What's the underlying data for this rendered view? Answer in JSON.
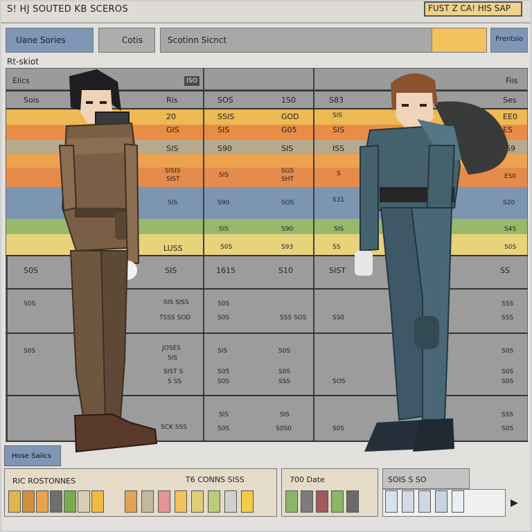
{
  "app": {
    "title": "S! HJ SOUTED KB SCEROS",
    "top_right": "FUST Z CA! HIS SAP"
  },
  "nav": {
    "tab1": "Uane Sories",
    "tab2": "Cotis",
    "search": "Scotinn Sicnct",
    "btn": "Prentsio"
  },
  "subheader": "Rt-skiot",
  "table": {
    "header_left": "Eiics",
    "header_badge": "ISO",
    "header_right": "Fiis",
    "rows": [
      {
        "c1": "Sois",
        "c2": "Ris",
        "c3": "SOS",
        "c4": "1S0",
        "c5": "S83",
        "c6": "Ses"
      },
      {
        "c2": "20",
        "c3": "SSIS",
        "c4": "GOD",
        "c5": "SIS",
        "c6": "EE0"
      },
      {
        "c2": "GIS",
        "c3": "SIS",
        "c4": "G05",
        "c5": "SIS",
        "c6": "ES"
      },
      {
        "c2": "SIS",
        "c3": "S90",
        "c4": "SIS",
        "c5": "ISS",
        "c6": "S9"
      },
      {
        "c2a": "SISIS",
        "c2": "SIST",
        "c3": "SIS",
        "c4": "SGS",
        "c4b": "SHT",
        "c5": "S",
        "c6": "ES0"
      },
      {
        "c2": "SIS",
        "c3": "S90",
        "c4": "SOS",
        "c5": "S31",
        "c6": "S20"
      },
      {
        "c3": "SIS",
        "c4": "S90",
        "c5": "SIS",
        "c6": "S4S"
      },
      {
        "c2": "LUSS",
        "c3": "S0S",
        "c4": "S93",
        "c5": "SS",
        "c6": "S0S"
      }
    ],
    "lower": {
      "r1": {
        "c1": "S0S",
        "c2": "SIS",
        "c3": "1615",
        "c4": "S10",
        "c5": "SIST",
        "c6": "SS"
      },
      "r2": {
        "c1": "S0S",
        "c2a": "SIS SISS",
        "c2b": "TSSS SOD",
        "c3a": "S0S",
        "c3b": "S0S",
        "c4": "SSS SOS",
        "c5": "SS0",
        "c6a": "SSS",
        "c6b": "SSS"
      },
      "r3": {
        "c1": "S0S",
        "c2a": "JOSES",
        "c2b": "SIS",
        "c2c": "SIST S",
        "c2d": "S SS",
        "c3a": "SIS",
        "c3b": "S05",
        "c3c": "S0S",
        "c4a": "S0S",
        "c4b": "S0S",
        "c4c": "SSS",
        "c5": "SOS",
        "c6a": "S0S",
        "c6b": "S0S",
        "c6c": "S0S"
      },
      "r4": {
        "c2": "SCK SSS",
        "c3a": "SIS",
        "c3b": "S0S",
        "c4a": "SIS",
        "c4b": "S0S0",
        "c5": "S0S",
        "c6a": "SSS",
        "c6b": "S0S"
      }
    }
  },
  "footer": {
    "label": "Hose Saiics",
    "palette1": {
      "title": "RIC ROSTONNES",
      "subtitle": "T6 CONNS SISS"
    },
    "palette2": {
      "title": "700 Date"
    },
    "palette3": {
      "title": "SOIS S SO"
    }
  },
  "colors": {
    "band_yellow": "#f2c55e",
    "band_orange": "#ef8d3f",
    "band_blue": "#7f96b7",
    "band_green": "#9ab86a",
    "swatches1": [
      "#e0b54e",
      "#d38f3c",
      "#e8a449",
      "#6e6e6e",
      "#7bab4c",
      "#d8d0b6",
      "#f2b943"
    ],
    "swatches2": [
      "#e0a35a",
      "#c4b89b",
      "#e69494",
      "#f2c35d",
      "#e1cc79",
      "#b8cc7c",
      "#d0d0d0",
      "#f4c94c"
    ],
    "swatches3": [
      "#8bb568",
      "#7c7c7c",
      "#a05a5a",
      "#8bb568",
      "#6b6b6b"
    ],
    "swatches4": [
      "#d8e2ee",
      "#d2dbe6",
      "#cdd8e4",
      "#c7d3e1",
      "#e9eef4"
    ]
  }
}
